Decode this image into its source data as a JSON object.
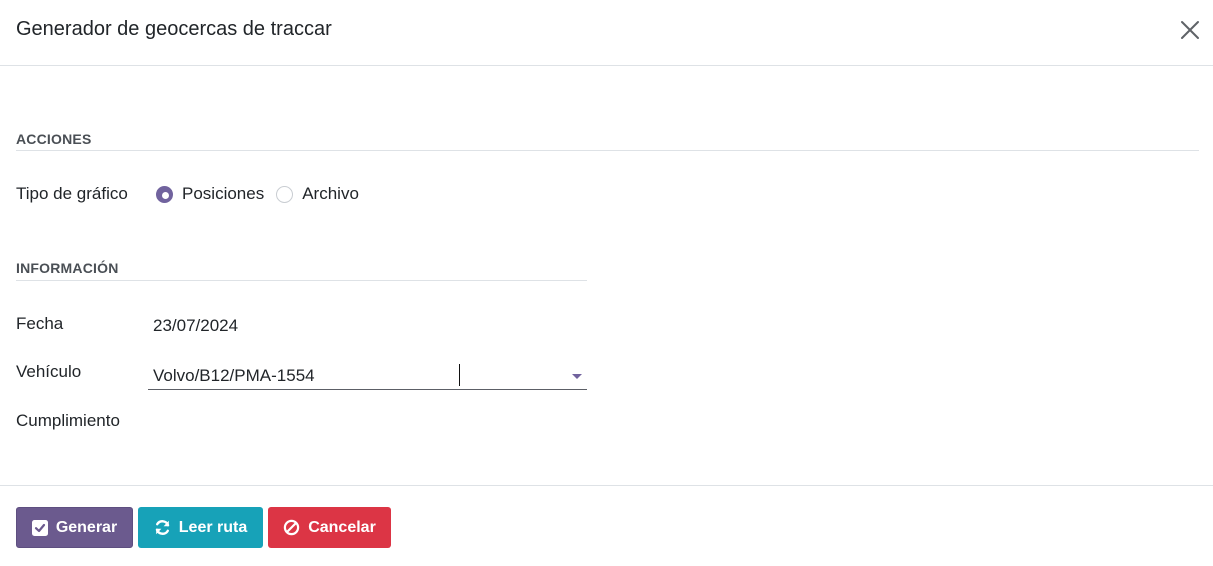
{
  "dialog": {
    "title": "Generador de geocercas de traccar"
  },
  "acciones": {
    "section_title": "ACCIONES",
    "tipo_label": "Tipo de gráfico",
    "options": [
      {
        "label": "Posiciones",
        "checked": true
      },
      {
        "label": "Archivo",
        "checked": false
      }
    ]
  },
  "informacion": {
    "section_title": "INFORMACIÓN",
    "fecha_label": "Fecha",
    "fecha_value": "23/07/2024",
    "vehiculo_label": "Vehículo",
    "vehiculo_value": "Volvo/B12/PMA-1554",
    "cumplimiento_label": "Cumplimiento"
  },
  "footer": {
    "generar_label": "Generar",
    "leer_label": "Leer ruta",
    "cancelar_label": "Cancelar"
  },
  "colors": {
    "primary": "#6b5a8e",
    "info": "#17a2b8",
    "danger": "#dc3545",
    "radio": "#71639e"
  }
}
